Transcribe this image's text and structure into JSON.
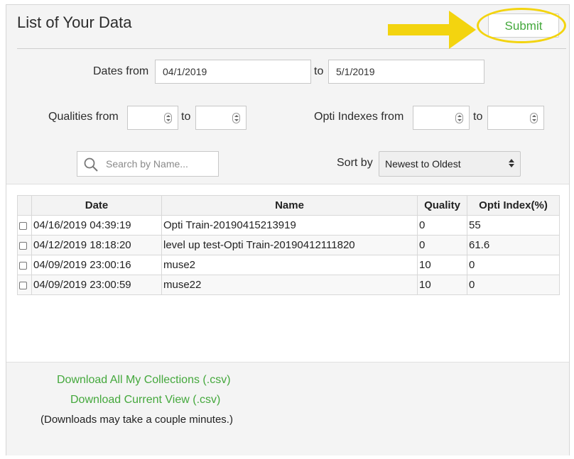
{
  "header": {
    "title": "List of Your Data",
    "submit_label": "Submit",
    "highlight_color": "#f3d40f"
  },
  "filters": {
    "dates_label": "Dates from",
    "date_from": "04/1/2019",
    "to_label": "to",
    "date_to": "5/1/2019",
    "qualities_label": "Qualities from",
    "qualities_to_label": "to",
    "opti_label": "Opti Indexes from",
    "opti_to_label": "to",
    "search_placeholder": "Search by Name...",
    "sort_label": "Sort by",
    "sort_value": "Newest to Oldest"
  },
  "table": {
    "columns": [
      "Date",
      "Name",
      "Quality",
      "Opti Index(%)"
    ],
    "rows": [
      {
        "date": "04/16/2019 04:39:19",
        "name": "Opti Train-20190415213919",
        "quality": "0",
        "opti": "55"
      },
      {
        "date": "04/12/2019 18:18:20",
        "name": "level up test-Opti Train-20190412111820",
        "quality": "0",
        "opti": "61.6"
      },
      {
        "date": "04/09/2019 23:00:16",
        "name": "muse2",
        "quality": "10",
        "opti": "0"
      },
      {
        "date": "04/09/2019 23:00:59",
        "name": "muse22",
        "quality": "10",
        "opti": "0"
      }
    ]
  },
  "downloads": {
    "all_label": "Download All My Collections (.csv)",
    "current_label": "Download Current View (.csv)",
    "note": "(Downloads may take a couple minutes.)",
    "link_color": "#44a83c"
  }
}
